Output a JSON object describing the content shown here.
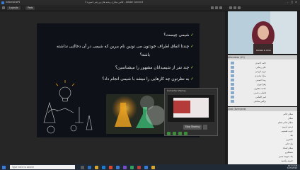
{
  "window": {
    "title": "InformatixPS",
    "center_title": "کلاس مجازی رشته های ورزشی اسوره 3 - Adobe Connect",
    "minimize": "–",
    "maximize": "□",
    "close": "✕"
  },
  "toolbar": {
    "tab1": "Layouts",
    "tab2": "Pods"
  },
  "slide": {
    "bullets": [
      "شیمی چیست؟",
      "چندتا اتفاق اطراف خودتون می تونین نام ببرین که شیمی در آن دخالتی نداشته",
      "باشه؟",
      "چند نفر از شیمیدانان مشهور را میشناسین؟",
      "به نظرتون چه کارهایی را میشه با شیمی انجام داد؟"
    ],
    "check_glyph": "✓"
  },
  "popup": {
    "title": "Currently Sharing",
    "stop_label": "Stop Sharing"
  },
  "camera": {
    "name_label": "Camera & Voice"
  },
  "attendees": {
    "header": "Attendees (12)",
    "rows": [
      "حامد احمدی",
      "علی رضایی",
      "مریم کریمی",
      "سارا محمدی",
      "رضا حسینی",
      "زهرا نوری",
      "محمد جعفری",
      "فاطمه رحیمی",
      "امیر کاظمی",
      "نرگس صادقی"
    ]
  },
  "chat": {
    "header": "Chat (Everyone)",
    "lines": [
      "سلام خانم",
      "سلام",
      "سلام خانم معلم",
      "درس امروز",
      "خوب هستیم",
      "بله",
      "حاضرم",
      "بله خانم",
      "سلام استاد",
      "متشکرم",
      "بله متوجه شدم",
      "خسته نباشید"
    ]
  },
  "taskbar": {
    "search_placeholder": "Type here to search",
    "time": "10:24 AM",
    "date": "3/15/2020"
  },
  "colors": {
    "accent": "#3a7bd5",
    "check": "#9bd24a",
    "stop_red": "#c0392b"
  }
}
